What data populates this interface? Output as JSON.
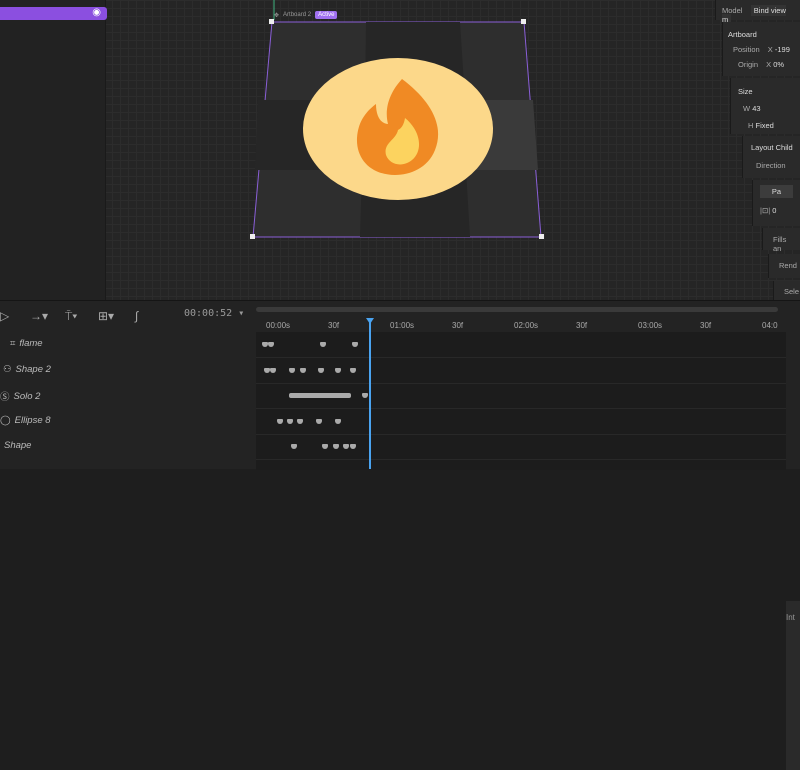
{
  "left_panel": {
    "layer_icon": "eye-icon"
  },
  "artboard": {
    "name": "Artboard 2",
    "badge": "Active",
    "fill_color": "#fcd88a",
    "flame_outer": "#f08a24",
    "flame_inner": "#fcd35f"
  },
  "right_panel": {
    "model_label": "Model",
    "model_value": "Bind view m",
    "artboard_title": "Artboard",
    "position_label": "Position",
    "position_axis": "X",
    "position_value": "-199",
    "origin_label": "Origin",
    "origin_axis": "X",
    "origin_value": "0%",
    "size_title": "Size",
    "width_label": "W",
    "width_value": "43",
    "height_label": "H",
    "height_mode": "Fixed",
    "layout_title": "Layout Child",
    "direction_label": "Direction",
    "pad_button": "Pa",
    "pad_value": "0",
    "fills_label": "Fills an",
    "render_label": "Rend",
    "select_label": "Sele"
  },
  "timeline": {
    "current_time": "00:00:52",
    "fps": 60,
    "playhead_frame": 52,
    "ruler": [
      "00:00s",
      "30f",
      "01:00s",
      "30f",
      "02:00s",
      "30f",
      "03:00s",
      "30f",
      "04:0"
    ],
    "side_label": "Int",
    "layers": [
      {
        "name": "flame",
        "keyframes": [
          0,
          3,
          28,
          43
        ]
      },
      {
        "name": "Shape 2",
        "keyframes": [
          1,
          4,
          13,
          18,
          27,
          35,
          42
        ]
      },
      {
        "name": "Solo 2",
        "keyframes": [
          48
        ],
        "range": [
          13,
          40
        ]
      },
      {
        "name": "Ellipse 8",
        "keyframes": [
          7,
          12,
          17,
          26,
          35
        ]
      },
      {
        "name": "Shape",
        "keyframes": [
          14,
          29,
          34,
          39,
          42
        ]
      }
    ]
  }
}
